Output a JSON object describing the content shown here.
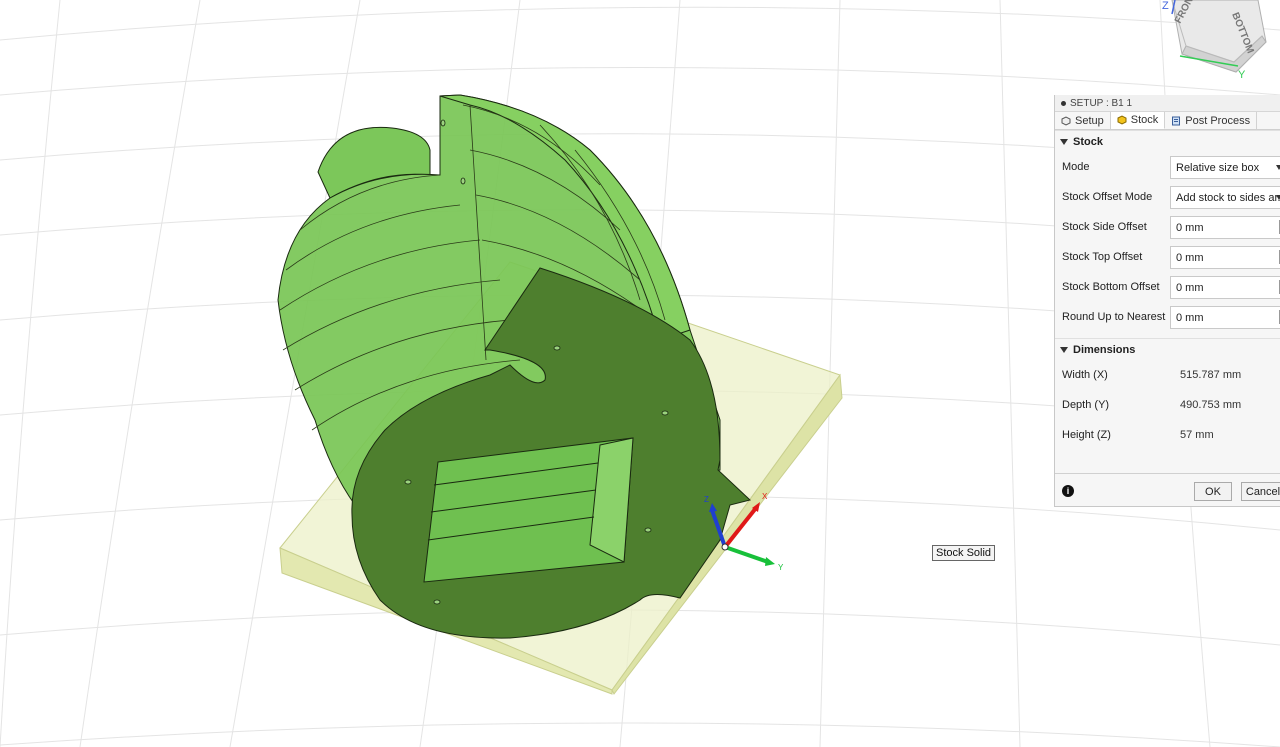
{
  "viewport": {
    "tooltip": "Stock Solid",
    "triad_labels": {
      "z": "Z",
      "x": "X",
      "y": "Y"
    },
    "viewcube": {
      "front": "FRONT",
      "bottom": "BOTTOM",
      "axis_z": "Z",
      "axis_y": "Y"
    },
    "colors": {
      "part": "#6cc247",
      "part_dark": "#4f8a32",
      "stock": "#e8eeb8",
      "grid": "#e6e6e6"
    }
  },
  "panel": {
    "title": "SETUP : B1 1",
    "tabs": [
      {
        "label": "Setup"
      },
      {
        "label": "Stock"
      },
      {
        "label": "Post Process"
      }
    ],
    "stock": {
      "header": "Stock",
      "mode_label": "Mode",
      "mode_value": "Relative size box",
      "offset_mode_label": "Stock Offset Mode",
      "offset_mode_value": "Add stock to sides ar...",
      "side_offset_label": "Stock Side Offset",
      "side_offset_value": "0 mm",
      "top_offset_label": "Stock Top Offset",
      "top_offset_value": "0 mm",
      "bottom_offset_label": "Stock Bottom Offset",
      "bottom_offset_value": "0 mm",
      "round_label": "Round Up to Nearest",
      "round_value": "0 mm"
    },
    "dimensions": {
      "header": "Dimensions",
      "width_label": "Width (X)",
      "width_value": "515.787 mm",
      "depth_label": "Depth (Y)",
      "depth_value": "490.753 mm",
      "height_label": "Height (Z)",
      "height_value": "57 mm"
    },
    "footer": {
      "ok": "OK",
      "cancel": "Cancel"
    }
  }
}
